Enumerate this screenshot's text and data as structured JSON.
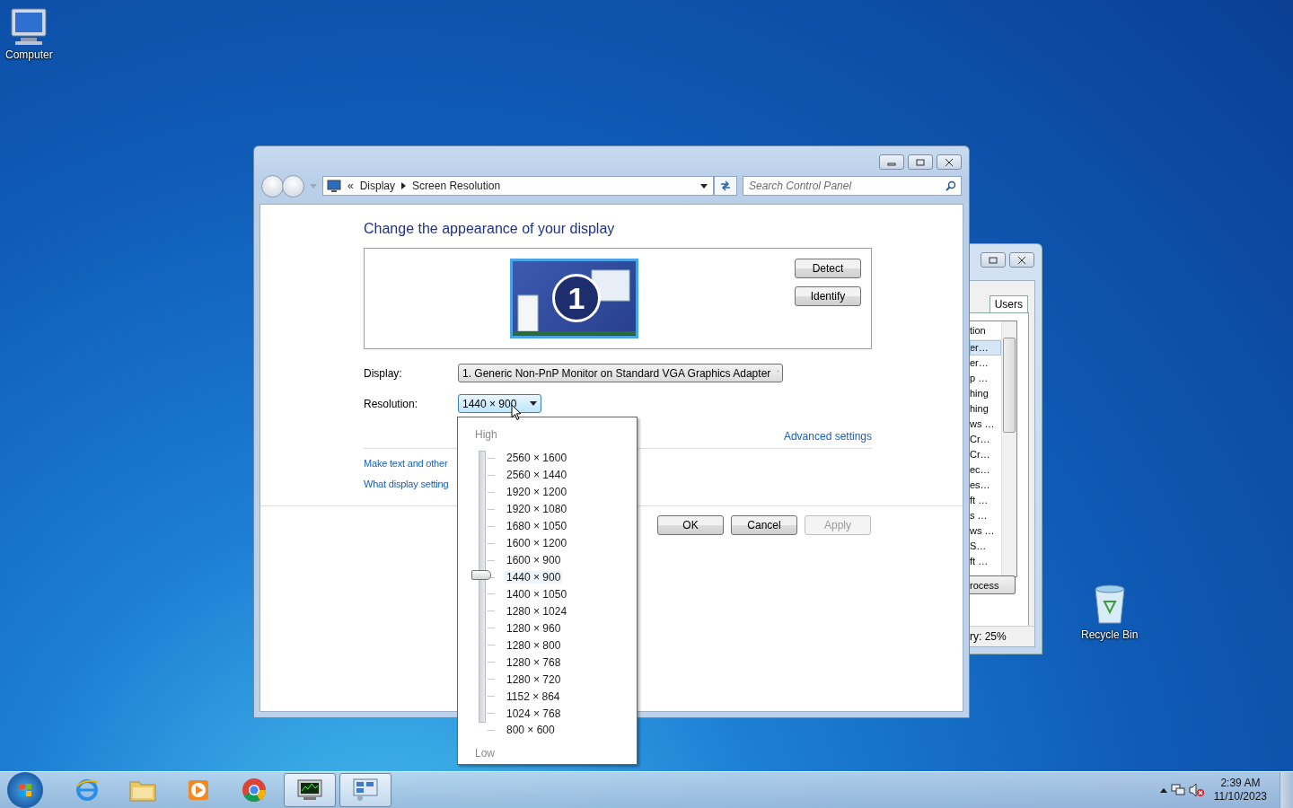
{
  "desktop_icons": [
    {
      "label": "Computer",
      "kind": "computer"
    },
    {
      "label": "Recycle Bin",
      "kind": "recycle-bin"
    }
  ],
  "task_manager_window": {
    "tab": "Users",
    "column_header": "tion",
    "rows": [
      {
        "text": "er…",
        "selected": true
      },
      {
        "text": "er…",
        "selected": false
      },
      {
        "text": "p …",
        "selected": false
      },
      {
        "text": "hing",
        "selected": false
      },
      {
        "text": "hing",
        "selected": false
      },
      {
        "text": "ws …",
        "selected": false
      },
      {
        "text": "Cr…",
        "selected": false
      },
      {
        "text": "Cr…",
        "selected": false
      },
      {
        "text": "ec…",
        "selected": false
      },
      {
        "text": "es…",
        "selected": false
      },
      {
        "text": "ft …",
        "selected": false
      },
      {
        "text": "s …",
        "selected": false
      },
      {
        "text": "ws …",
        "selected": false
      },
      {
        "text": "S…",
        "selected": false
      },
      {
        "text": "ft …",
        "selected": false
      }
    ],
    "button": "rocess",
    "status": "ry: 25%"
  },
  "main_window": {
    "breadcrumb": {
      "prefix": "«",
      "items": [
        "Display",
        "Screen Resolution"
      ]
    },
    "search": {
      "placeholder": "Search Control Panel"
    },
    "heading": "Change the appearance of your display",
    "monitor": {
      "number": "1"
    },
    "preview_buttons": [
      "Detect",
      "Identify"
    ],
    "display": {
      "label": "Display:",
      "value": "1. Generic Non-PnP Monitor on Standard VGA Graphics Adapter"
    },
    "resolution": {
      "label": "Resolution:",
      "value": "1440 × 900"
    },
    "advanced_link": "Advanced settings",
    "links": [
      "Make text and other",
      "What display setting"
    ],
    "buttons": [
      {
        "label": "OK",
        "disabled": false
      },
      {
        "label": "Cancel",
        "disabled": false
      },
      {
        "label": "Apply",
        "disabled": true
      }
    ]
  },
  "resolution_menu": {
    "high_label": "High",
    "low_label": "Low",
    "options": [
      {
        "label": "2560 × 1600",
        "selected": false
      },
      {
        "label": "2560 × 1440",
        "selected": false
      },
      {
        "label": "1920 × 1200",
        "selected": false
      },
      {
        "label": "1920 × 1080",
        "selected": false
      },
      {
        "label": "1680 × 1050",
        "selected": false
      },
      {
        "label": "1600 × 1200",
        "selected": false
      },
      {
        "label": "1600 × 900",
        "selected": false
      },
      {
        "label": "1440 × 900",
        "selected": true
      },
      {
        "label": "1400 × 1050",
        "selected": false
      },
      {
        "label": "1280 × 1024",
        "selected": false
      },
      {
        "label": "1280 × 960",
        "selected": false
      },
      {
        "label": "1280 × 800",
        "selected": false
      },
      {
        "label": "1280 × 768",
        "selected": false
      },
      {
        "label": "1280 × 720",
        "selected": false
      },
      {
        "label": "1152 × 864",
        "selected": false
      },
      {
        "label": "1024 × 768",
        "selected": false
      },
      {
        "label": "800 × 600",
        "selected": false
      }
    ]
  },
  "taskbar": {
    "apps": [
      {
        "kind": "browser-e",
        "active": false
      },
      {
        "kind": "folder",
        "active": false
      },
      {
        "kind": "media",
        "active": false
      },
      {
        "kind": "chrome",
        "active": false
      },
      {
        "kind": "task-manager",
        "active": true
      },
      {
        "kind": "control-panel",
        "active": true
      }
    ],
    "clock": {
      "time": "2:39 AM",
      "date": "11/10/2023"
    }
  }
}
